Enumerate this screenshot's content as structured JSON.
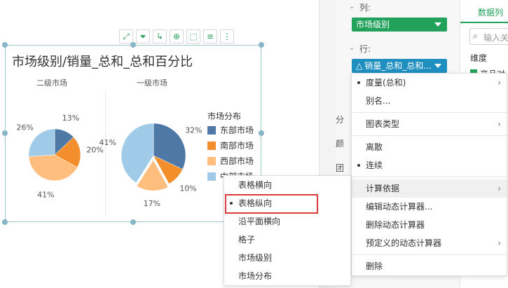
{
  "config": {
    "columns_label": "列:",
    "columns_pill": "市场级别",
    "rows_label": "行:",
    "rows_pill": "销量_总和_总和...",
    "side_labels": [
      "分",
      "颜",
      "团"
    ]
  },
  "datacols": {
    "tab": "数据列",
    "search_placeholder": "输入关",
    "dimension_label": "维度",
    "row_item": "产品对"
  },
  "toolbar": {
    "icons": [
      "expand-icon",
      "filter-icon",
      "drill-icon",
      "zoom-icon",
      "select-icon",
      "list-icon",
      "more-icon"
    ]
  },
  "chart": {
    "title": "市场级别/销量_总和_总和百分比",
    "pies": [
      {
        "label": "二级市场",
        "labels": [
          "13%",
          "20%",
          "41%",
          "26%"
        ]
      },
      {
        "label": "一级市场",
        "labels": [
          "32%",
          "10%",
          "17%",
          "41%"
        ]
      }
    ],
    "legend": {
      "title": "市场分布",
      "items": [
        "东部市场",
        "南部市场",
        "西部市场",
        "中部市场"
      ]
    }
  },
  "chart_data": {
    "type": "pie",
    "title": "市场级别/销量_总和_总和百分比",
    "categories": [
      "东部市场",
      "南部市场",
      "西部市场",
      "中部市场"
    ],
    "colors": [
      "#4e79a7",
      "#f28e2b",
      "#ffbe7d",
      "#a0cbe8"
    ],
    "series": [
      {
        "name": "二级市场",
        "values": [
          13,
          20,
          41,
          26
        ]
      },
      {
        "name": "一级市场",
        "values": [
          32,
          10,
          17,
          41
        ]
      }
    ]
  },
  "context_menu": {
    "items": [
      {
        "label": "度量(总和)",
        "dot": true,
        "sub": true
      },
      {
        "label": "别名...",
        "dot": false,
        "sub": false
      },
      {
        "sep": true
      },
      {
        "label": "图表类型",
        "dot": false,
        "sub": true
      },
      {
        "sep": true
      },
      {
        "label": "离散",
        "dot": false,
        "sub": false
      },
      {
        "label": "连续",
        "dot": true,
        "sub": false
      },
      {
        "sep": true
      },
      {
        "label": "计算依据",
        "dot": false,
        "sub": true,
        "hover": true
      },
      {
        "label": "编辑动态计算器...",
        "dot": false,
        "sub": false
      },
      {
        "label": "删除动态计算器",
        "dot": false,
        "sub": false
      },
      {
        "label": "预定义的动态计算器",
        "dot": false,
        "sub": true
      },
      {
        "sep": true
      },
      {
        "label": "删除",
        "dot": false,
        "sub": false
      }
    ]
  },
  "sub_menu": {
    "items": [
      {
        "label": "表格横向",
        "dot": false
      },
      {
        "label": "表格纵向",
        "dot": true,
        "selected": true
      },
      {
        "label": "沿平面横向",
        "dot": false
      },
      {
        "label": "格子",
        "dot": false
      },
      {
        "label": "市场级别",
        "dot": false
      },
      {
        "label": "市场分布",
        "dot": false
      }
    ]
  }
}
